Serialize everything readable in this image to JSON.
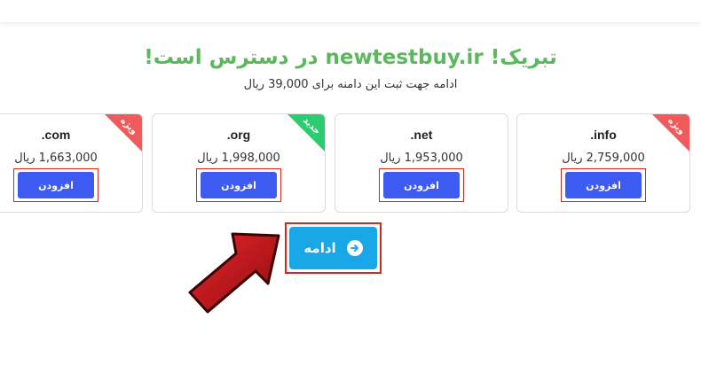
{
  "headline": "تبریک! newtestbuy.ir در دسترس است!",
  "subline": "ادامه جهت ثبت این دامنه برای 39,000 ریال",
  "cards": [
    {
      "tld": ".info",
      "price": "2,759,000 ریال",
      "button": "افزودن",
      "ribbon": "ویژه",
      "ribbon_color": "#f05a5a"
    },
    {
      "tld": ".net",
      "price": "1,953,000 ریال",
      "button": "افزودن",
      "ribbon": "",
      "ribbon_color": ""
    },
    {
      "tld": ".org",
      "price": "1,998,000 ریال",
      "button": "افزودن",
      "ribbon": "جدید",
      "ribbon_color": "#2ecc71"
    },
    {
      "tld": ".com",
      "price": "1,663,000 ریال",
      "button": "افزودن",
      "ribbon": "ویژه",
      "ribbon_color": "#f05a5a"
    }
  ],
  "continue": {
    "label": "ادامه",
    "icon": "arrow-right-circle-icon"
  },
  "colors": {
    "headline": "#5cb85c",
    "add_button": "#3d5af1",
    "continue_button": "#1aa7e8",
    "highlight": "#d9241c",
    "pointer_arrow": "#c8171c"
  }
}
